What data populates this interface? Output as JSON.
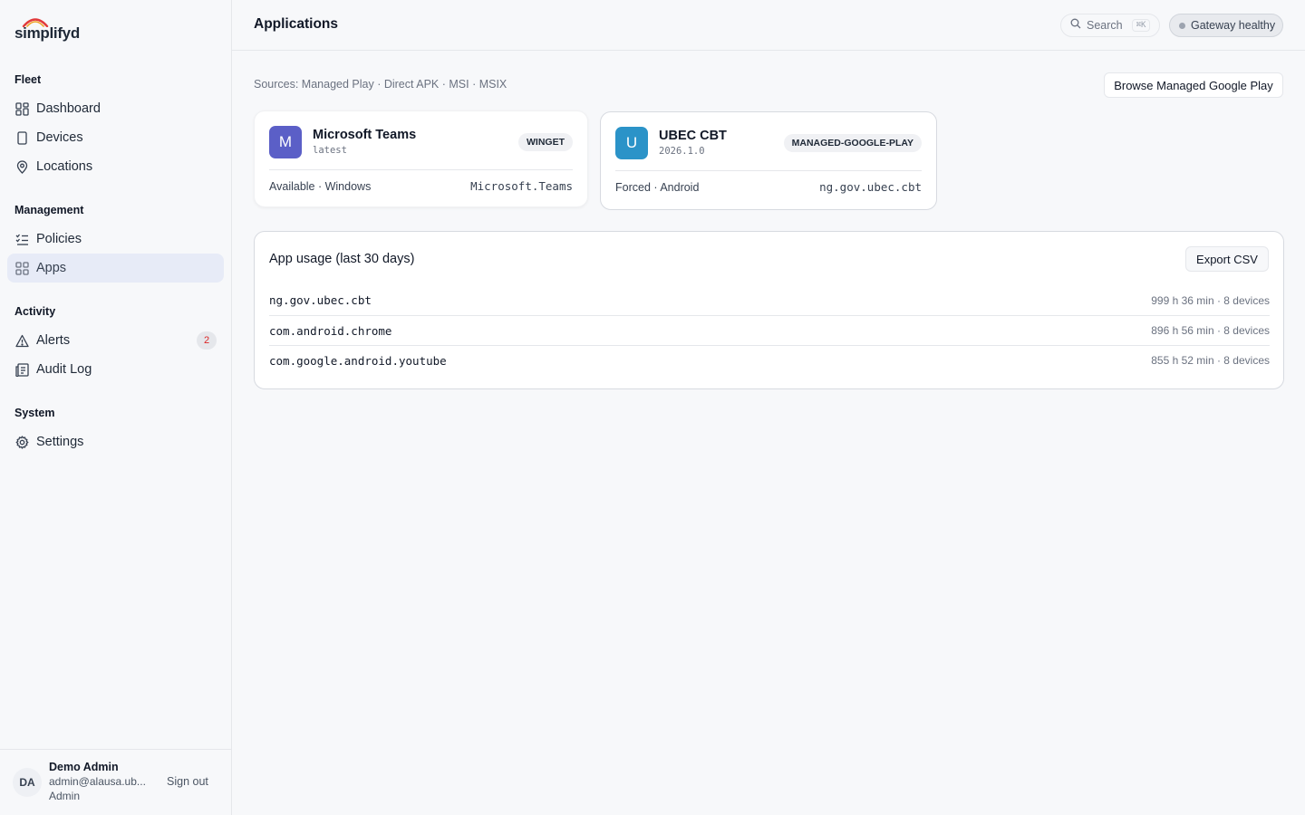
{
  "brand": {
    "name": "simplifyd"
  },
  "sidebar": {
    "sections": [
      {
        "title": "Fleet",
        "items": [
          {
            "label": "Dashboard",
            "icon": "dashboard-icon"
          },
          {
            "label": "Devices",
            "icon": "device-icon"
          },
          {
            "label": "Locations",
            "icon": "location-pin-icon"
          }
        ]
      },
      {
        "title": "Management",
        "items": [
          {
            "label": "Policies",
            "icon": "checklist-icon"
          },
          {
            "label": "Apps",
            "icon": "apps-grid-icon",
            "active": true
          }
        ]
      },
      {
        "title": "Activity",
        "items": [
          {
            "label": "Alerts",
            "icon": "alert-triangle-icon",
            "count": "2"
          },
          {
            "label": "Audit Log",
            "icon": "audit-log-icon"
          }
        ]
      },
      {
        "title": "System",
        "items": [
          {
            "label": "Settings",
            "icon": "gear-icon"
          }
        ]
      }
    ],
    "user": {
      "initials": "DA",
      "name": "Demo Admin",
      "email": "admin@alausa.ub...",
      "role": "Admin",
      "signout_label": "Sign out"
    }
  },
  "header": {
    "title": "Applications",
    "search_label": "Search",
    "search_shortcut": "⌘K",
    "gateway_status": "Gateway healthy"
  },
  "main": {
    "sources": "Sources: Managed Play · Direct APK · MSI · MSIX",
    "browse_button": "Browse Managed Google Play",
    "apps": [
      {
        "initial": "M",
        "name": "Microsoft Teams",
        "version": "latest",
        "source": "WINGET",
        "status": "Available · Windows",
        "package": "Microsoft.Teams",
        "color": "#5b5fc7"
      },
      {
        "initial": "U",
        "name": "UBEC CBT",
        "version": "2026.1.0",
        "source": "MANAGED-GOOGLE-PLAY",
        "status": "Forced · Android",
        "package": "ng.gov.ubec.cbt",
        "color": "#2b93c8"
      }
    ],
    "usage": {
      "title": "App usage (last 30 days)",
      "export_button": "Export CSV",
      "rows": [
        {
          "package": "ng.gov.ubec.cbt",
          "value": "999 h 36 min · 8 devices"
        },
        {
          "package": "com.android.chrome",
          "value": "896 h 56 min · 8 devices"
        },
        {
          "package": "com.google.android.youtube",
          "value": "855 h 52 min · 8 devices"
        }
      ]
    }
  },
  "colors": {
    "active_nav": "#e7ebf7",
    "alert_count": "#dc2626",
    "logo_arc_red": "#e23b3b",
    "logo_arc_orange": "#f0a020"
  }
}
